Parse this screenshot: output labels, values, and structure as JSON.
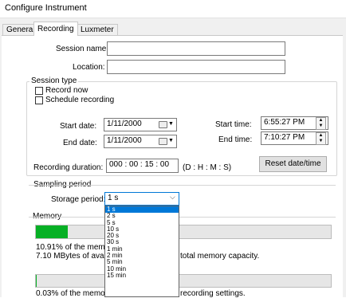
{
  "window": {
    "title": "Configure Instrument"
  },
  "tabs": [
    {
      "label": "General",
      "active": false
    },
    {
      "label": "Recording",
      "active": true
    },
    {
      "label": "Luxmeter",
      "active": false
    }
  ],
  "session_name": {
    "label": "Session name:",
    "value": ""
  },
  "location": {
    "label": "Location:",
    "value": ""
  },
  "session_type": {
    "legend": "Session type",
    "record_now": {
      "label": "Record now",
      "checked": false
    },
    "schedule_recording": {
      "label": "Schedule recording",
      "checked": false
    }
  },
  "start_date": {
    "label": "Start date:",
    "value": "1/11/2000"
  },
  "end_date": {
    "label": "End date:",
    "value": "1/11/2000"
  },
  "start_time": {
    "label": "Start time:",
    "value": "6:55:27 PM"
  },
  "end_time": {
    "label": "End time:",
    "value": "7:10:27 PM"
  },
  "recording_duration": {
    "label": "Recording duration:",
    "value": "000 : 00 : 15 : 00",
    "format": "(D : H : M : S)"
  },
  "reset_button": {
    "label": "Reset date/time"
  },
  "sampling": {
    "legend": "Sampling period",
    "storage_label": "Storage period:",
    "selected": "1 s",
    "options": [
      "1 s",
      "2 s",
      "5 s",
      "10 s",
      "20 s",
      "30 s",
      "1 min",
      "2 min",
      "5 min",
      "10 min",
      "15 min"
    ]
  },
  "memory": {
    "legend": "Memory",
    "usage_bar_fraction": 0.1091,
    "line1": "10.91% of the memory",
    "line2": "7.10 MBytes of availab",
    "line2_tail": "total memory capacity.",
    "estimate_bar_fraction": 0.0003,
    "line3": "0.03% of the memory",
    "line3_tail": "recording settings."
  },
  "colors": {
    "selection": "#0078d7",
    "progress": "#06b025"
  },
  "icons": {
    "calendar": "calendar-dropdown-icon",
    "spin": "spin-up-down-icon",
    "chevron": "chevron-down-icon"
  }
}
